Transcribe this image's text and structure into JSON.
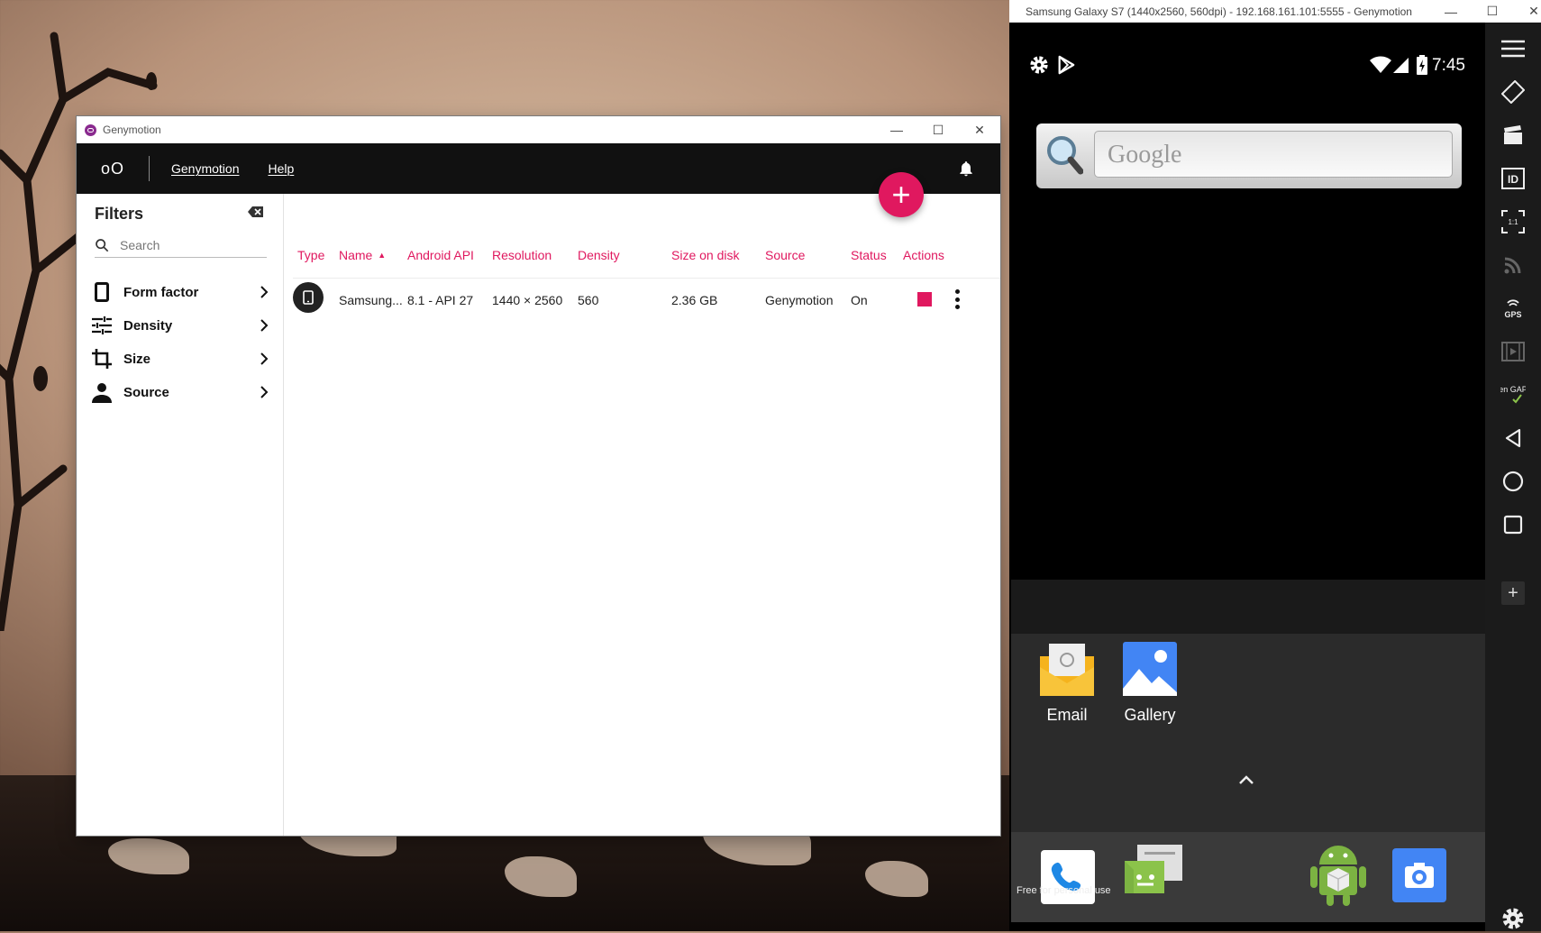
{
  "genymotion": {
    "window_title": "Genymotion",
    "logo": "oO",
    "menu": {
      "genymotion": "Genymotion",
      "help": "Help"
    },
    "fab_label": "+",
    "filters": {
      "title": "Filters",
      "search_placeholder": "Search",
      "items": [
        {
          "label": "Form factor",
          "icon": "phone-outline-icon"
        },
        {
          "label": "Density",
          "icon": "tune-sliders-icon"
        },
        {
          "label": "Size",
          "icon": "crop-icon"
        },
        {
          "label": "Source",
          "icon": "person-icon"
        }
      ]
    },
    "table": {
      "headers": {
        "type": "Type",
        "name": "Name",
        "api": "Android API",
        "resolution": "Resolution",
        "density": "Density",
        "size": "Size on disk",
        "source": "Source",
        "status": "Status",
        "actions": "Actions"
      },
      "sort_column": "name",
      "sort_direction": "ascending",
      "row": {
        "name": "Samsung...",
        "api": "8.1 - API 27",
        "resolution": "1440 × 2560",
        "density": "560",
        "size": "2.36 GB",
        "source": "Genymotion",
        "status": "On"
      }
    },
    "accent_color": "#e0185f"
  },
  "emulator": {
    "window_title": "Samsung Galaxy S7 (1440x2560, 560dpi) - 192.168.161.101:5555 - Genymotion",
    "status_bar": {
      "time": "7:45"
    },
    "search_widget": {
      "placeholder": "Google"
    },
    "drawer_apps": [
      {
        "label": "Email",
        "icon": "email-icon"
      },
      {
        "label": "Gallery",
        "icon": "gallery-icon"
      }
    ],
    "dock_apps": [
      "phone-icon",
      "messaging-icon",
      "android-app-icon",
      "camera-icon"
    ],
    "watermark": "Free for personal use",
    "toolbar": [
      "menu-icon",
      "rotate-icon",
      "capture-icon",
      "device-id-icon",
      "pixel-perfect-icon",
      "network-icon",
      "gps-icon",
      "screencast-icon",
      "open-gapps-icon",
      "back-icon",
      "home-icon",
      "recents-icon",
      "add-widget-icon",
      "settings-icon"
    ],
    "toolbar_labels": {
      "gps": "GPS",
      "open_gapps": "Open GAPPS",
      "id": "ID",
      "pixel_perfect": "1:1"
    }
  }
}
